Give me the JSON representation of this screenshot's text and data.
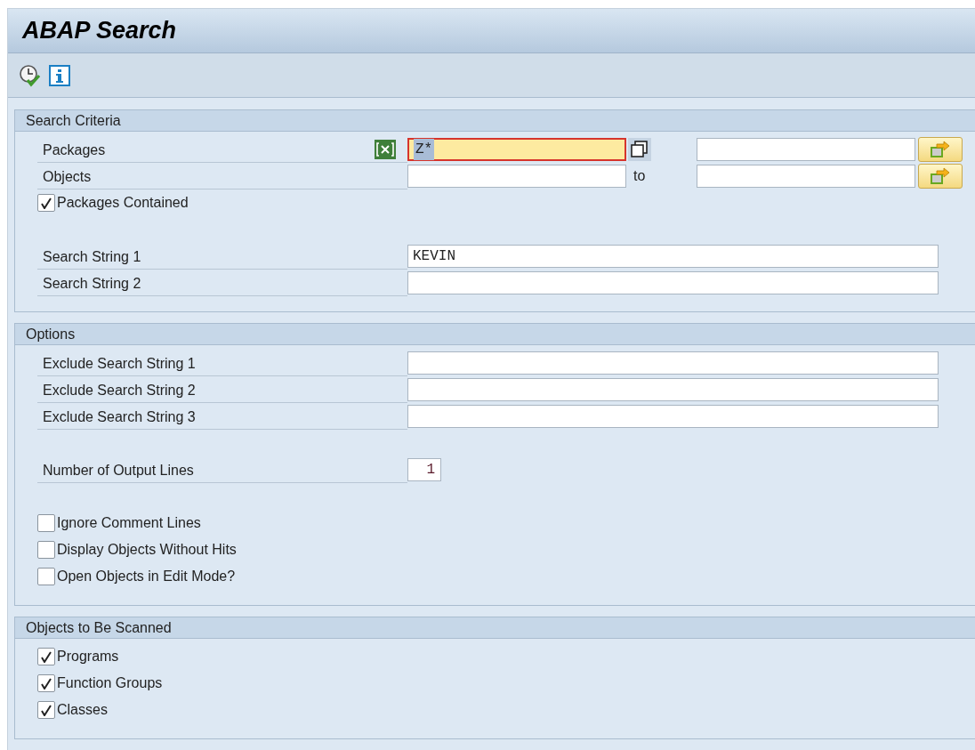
{
  "window": {
    "title": "ABAP Search"
  },
  "toolbar": [
    {
      "kind": "execute"
    },
    {
      "kind": "info"
    }
  ],
  "sections": [
    {
      "title": "Search Criteria",
      "groups": [
        [
          {
            "kind": "range",
            "label": "Packages",
            "from": "Z*",
            "focused": true,
            "selection_icon": true
          },
          {
            "kind": "range",
            "label": "Objects",
            "to_label": "to",
            "focused": false,
            "selection_icon": false
          },
          {
            "kind": "checkbox",
            "label": "Packages Contained",
            "checked": true
          }
        ],
        [
          {
            "kind": "field",
            "label": "Search String 1",
            "value": "KEVIN"
          },
          {
            "kind": "field",
            "label": "Search String 2"
          }
        ]
      ]
    },
    {
      "title": "Options",
      "groups": [
        [
          {
            "kind": "field",
            "label": "Exclude Search String 1"
          },
          {
            "kind": "field",
            "label": "Exclude Search String 2"
          },
          {
            "kind": "field",
            "label": "Exclude Search String 3"
          }
        ],
        [
          {
            "kind": "number",
            "label": "Number of Output Lines",
            "value": "1"
          }
        ],
        [
          {
            "kind": "checkbox",
            "label": "Ignore Comment Lines",
            "checked": false
          },
          {
            "kind": "checkbox",
            "label": "Display Objects Without Hits",
            "checked": false
          },
          {
            "kind": "checkbox",
            "label": "Open Objects in Edit Mode?",
            "checked": false
          }
        ]
      ]
    },
    {
      "title": "Objects to Be Scanned",
      "groups": [
        [
          {
            "kind": "checkbox",
            "label": "Programs",
            "checked": true
          },
          {
            "kind": "checkbox",
            "label": "Function Groups",
            "checked": true
          },
          {
            "kind": "checkbox",
            "label": "Classes",
            "checked": true
          }
        ]
      ]
    }
  ]
}
